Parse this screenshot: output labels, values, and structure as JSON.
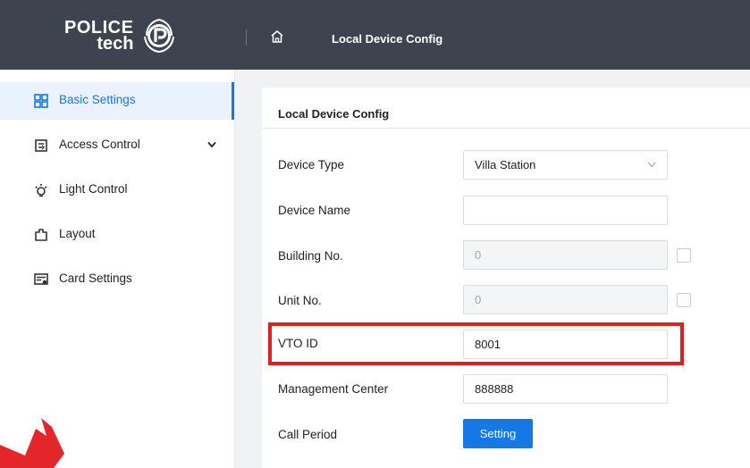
{
  "header": {
    "logo_line1": "POLICE",
    "logo_line2": "tech",
    "title": "Local Device Config"
  },
  "sidebar": {
    "items": [
      {
        "label": "Basic Settings",
        "icon": "grid-icon",
        "active": true
      },
      {
        "label": "Access Control",
        "icon": "door-icon",
        "expandable": true
      },
      {
        "label": "Light Control",
        "icon": "bulb-icon"
      },
      {
        "label": "Layout",
        "icon": "layout-icon"
      },
      {
        "label": "Card Settings",
        "icon": "card-icon"
      }
    ]
  },
  "main": {
    "section_title": "Local Device Config",
    "fields": {
      "device_type": {
        "label": "Device Type",
        "value": "Villa Station"
      },
      "device_name": {
        "label": "Device Name",
        "value": ""
      },
      "building_no": {
        "label": "Building No.",
        "value": "0"
      },
      "unit_no": {
        "label": "Unit No.",
        "value": "0"
      },
      "vto_id": {
        "label": "VTO ID",
        "value": "8001"
      },
      "management_center": {
        "label": "Management Center",
        "value": "888888"
      },
      "call_period": {
        "label": "Call Period",
        "button": "Setting"
      }
    }
  },
  "colors": {
    "header_bg": "#3d4450",
    "accent": "#1677e6",
    "highlight": "#e02020"
  }
}
